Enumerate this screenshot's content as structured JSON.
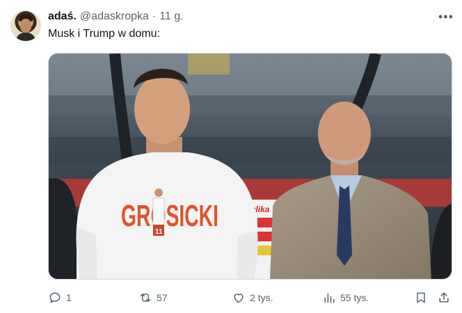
{
  "tweet": {
    "display_name": "adaś.",
    "handle": "@adaskropka",
    "separator": "·",
    "time": "11 g.",
    "text": "Musk i Trump w domu:",
    "media": {
      "shirt_text": "GROSICKI",
      "shirt_number": "11",
      "board_text": "ulika"
    },
    "stats": {
      "replies": "1",
      "retweets": "57",
      "likes": "2 tys.",
      "views": "55 tys."
    }
  },
  "icons": [
    "more-icon",
    "reply-icon",
    "retweet-icon",
    "like-icon",
    "views-icon",
    "bookmark-icon",
    "share-icon"
  ],
  "colors": {
    "text": "#0f1419",
    "muted": "#536471",
    "border": "#cfd9de",
    "shirt_print": "#e0532f"
  }
}
